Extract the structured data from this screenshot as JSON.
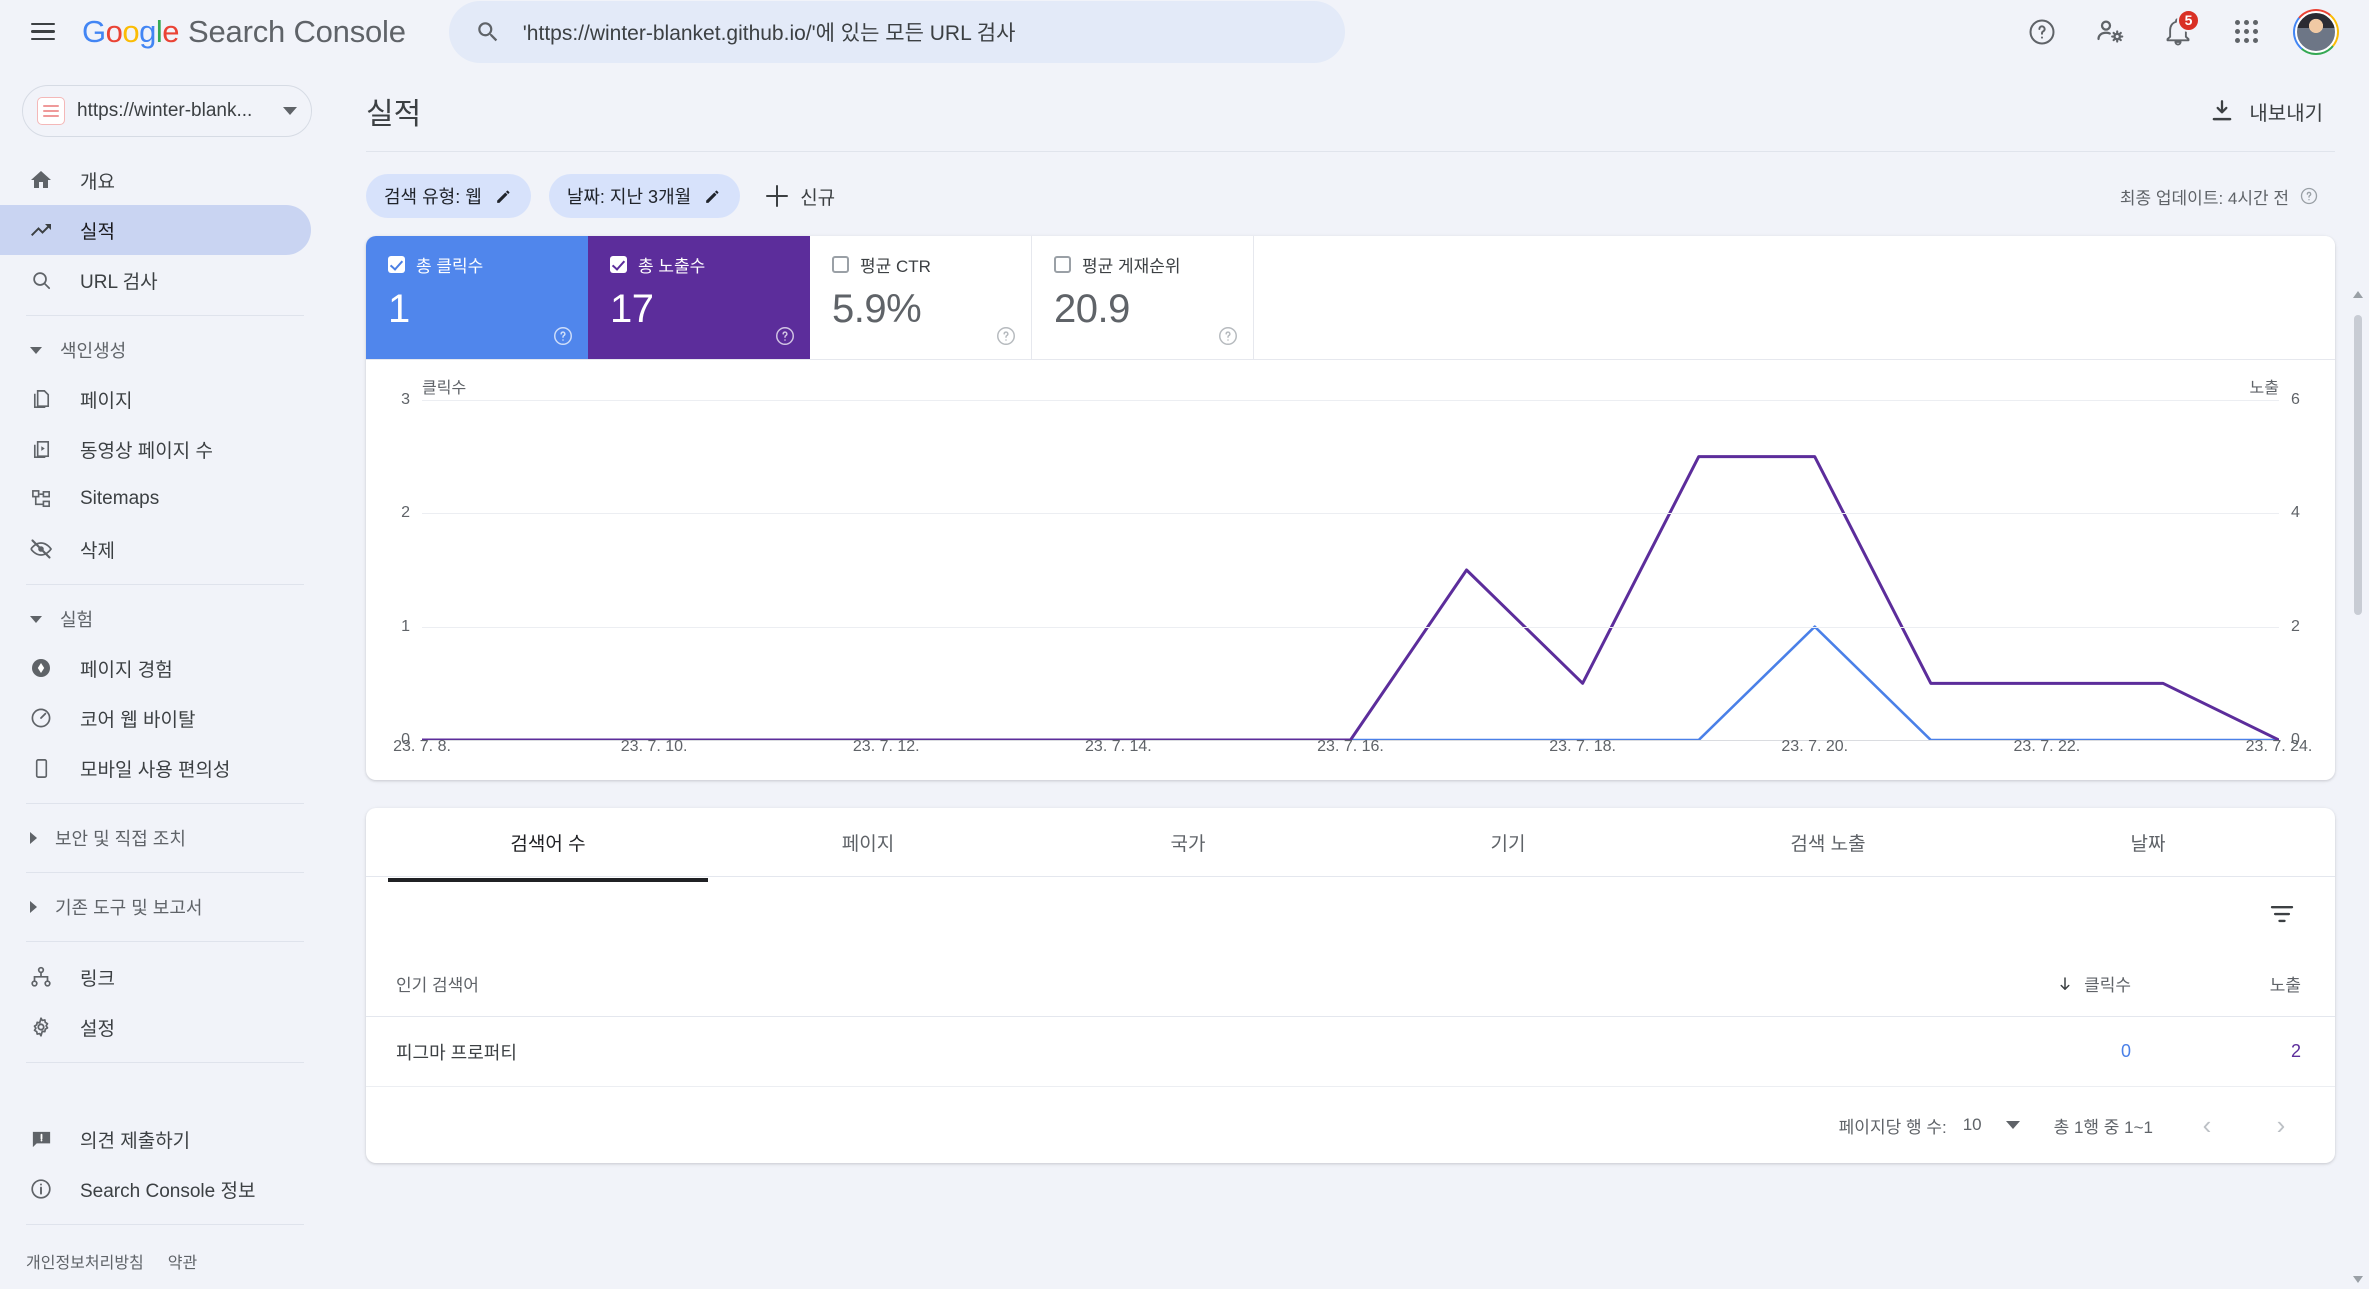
{
  "topbar": {
    "menu_label": "menu",
    "brand_google": "Google",
    "brand_product": "Search Console",
    "search": {
      "value": "'https://winter-blanket.github.io/'에 있는 모든 URL 검사",
      "placeholder": "URL 검사"
    },
    "help_label": "도움말",
    "account_label": "계정",
    "notifications_badge": "5",
    "apps_label": "Google 앱"
  },
  "sidebar": {
    "property": {
      "label": "https://winter-blank...",
      "full": "https://winter-blanket.github.io/"
    },
    "items": [
      {
        "label": "개요",
        "icon": "home-icon",
        "active": false
      },
      {
        "label": "실적",
        "icon": "trending-up-icon",
        "active": true
      },
      {
        "label": "URL 검사",
        "icon": "search-icon",
        "active": false
      }
    ],
    "group_index": {
      "label": "색인생성",
      "expanded": true
    },
    "index_items": [
      {
        "label": "페이지",
        "icon": "pages-icon"
      },
      {
        "label": "동영상 페이지 수",
        "icon": "video-pages-icon"
      },
      {
        "label": "Sitemaps",
        "icon": "sitemap-icon"
      },
      {
        "label": "삭제",
        "icon": "eye-off-icon"
      }
    ],
    "group_experience": {
      "label": "실험",
      "expanded": true
    },
    "experience_items": [
      {
        "label": "페이지 경험",
        "icon": "page-experience-icon"
      },
      {
        "label": "코어 웹 바이탈",
        "icon": "speedometer-icon"
      },
      {
        "label": "모바일 사용 편의성",
        "icon": "mobile-icon"
      }
    ],
    "group_security": {
      "label": "보안 및 직접 조치",
      "expanded": false
    },
    "group_legacy": {
      "label": "기존 도구 및 보고서",
      "expanded": false
    },
    "bottom_items": [
      {
        "label": "링크",
        "icon": "links-icon"
      },
      {
        "label": "설정",
        "icon": "gear-icon"
      }
    ],
    "footer_items": [
      {
        "label": "의견 제출하기",
        "icon": "feedback-icon"
      },
      {
        "label": "Search Console 정보",
        "icon": "info-icon"
      }
    ],
    "legal": [
      {
        "label": "개인정보처리방침"
      },
      {
        "label": "약관"
      }
    ]
  },
  "page": {
    "title": "실적",
    "export_label": "내보내기",
    "last_update": "최종 업데이트: 4시간 전"
  },
  "filters": {
    "chips": [
      {
        "label": "검색 유형: 웹",
        "icon": "pencil-icon"
      },
      {
        "label": "날짜: 지난 3개월",
        "icon": "pencil-icon"
      }
    ],
    "new_label": "신규"
  },
  "metrics": [
    {
      "key": "clicks",
      "label": "총 클릭수",
      "value": "1",
      "checked": true,
      "color": "#5086ec"
    },
    {
      "key": "impressions",
      "label": "총 노출수",
      "value": "17",
      "checked": true,
      "color": "#5c2d9b"
    },
    {
      "key": "ctr",
      "label": "평균 CTR",
      "value": "5.9%",
      "checked": false,
      "color": "#ffffff"
    },
    {
      "key": "position",
      "label": "평균 게재순위",
      "value": "20.9",
      "checked": false,
      "color": "#ffffff"
    }
  ],
  "chart_data": {
    "type": "line",
    "title": "",
    "xlabel": "",
    "ylabel_left": "클릭수",
    "ylabel_right": "노출",
    "grid": true,
    "legend_position": "none",
    "ylim_left": [
      0,
      3
    ],
    "ylim_right": [
      0,
      6
    ],
    "yticks_left": [
      "0",
      "1",
      "2",
      "3"
    ],
    "yticks_right": [
      "0",
      "2",
      "4",
      "6"
    ],
    "x": [
      "23. 7. 8.",
      "23. 7. 9.",
      "23. 7. 10.",
      "23. 7. 11.",
      "23. 7. 12.",
      "23. 7. 13.",
      "23. 7. 14.",
      "23. 7. 15.",
      "23. 7. 16.",
      "23. 7. 17.",
      "23. 7. 18.",
      "23. 7. 19.",
      "23. 7. 20.",
      "23. 7. 21.",
      "23. 7. 22.",
      "23. 7. 23.",
      "23. 7. 24."
    ],
    "xtick_labels": [
      "23. 7. 8.",
      "23. 7. 10.",
      "23. 7. 12.",
      "23. 7. 14.",
      "23. 7. 16.",
      "23. 7. 18.",
      "23. 7. 20.",
      "23. 7. 22.",
      "23. 7. 24."
    ],
    "series": [
      {
        "name": "클릭수",
        "color": "#4a80e8",
        "axis": "left",
        "values": [
          0,
          0,
          0,
          0,
          0,
          0,
          0,
          0,
          0,
          0,
          0,
          0,
          1,
          0,
          0,
          0,
          0
        ]
      },
      {
        "name": "노출",
        "color": "#5c2d9b",
        "axis": "right",
        "values": [
          0,
          0,
          0,
          0,
          0,
          0,
          0,
          0,
          0,
          3,
          1,
          5,
          5,
          1,
          1,
          1,
          0
        ]
      }
    ]
  },
  "table": {
    "tabs": [
      {
        "label": "검색어 수",
        "active": true
      },
      {
        "label": "페이지",
        "active": false
      },
      {
        "label": "국가",
        "active": false
      },
      {
        "label": "기기",
        "active": false
      },
      {
        "label": "검색 노출",
        "active": false
      },
      {
        "label": "날짜",
        "active": false
      }
    ],
    "filter_icon": "filter-list-icon",
    "columns": [
      {
        "label": "인기 검색어",
        "align": "left",
        "sorted": false
      },
      {
        "label": "클릭수",
        "align": "right",
        "sorted": true,
        "sort_dir": "desc"
      },
      {
        "label": "노출",
        "align": "right",
        "sorted": false
      }
    ],
    "rows": [
      {
        "query": "피그마 프로퍼티",
        "clicks": "0",
        "impressions": "2"
      }
    ],
    "pager": {
      "rows_per_page_label": "페이지당 행 수:",
      "rows_per_page_value": "10",
      "range_label": "총 1행 중 1~1",
      "prev_label": "이전 페이지",
      "next_label": "다음 페이지"
    }
  }
}
